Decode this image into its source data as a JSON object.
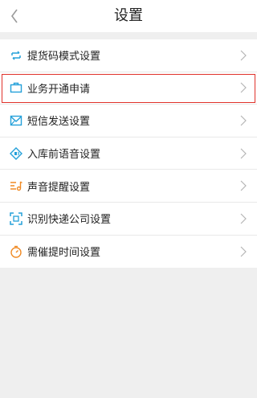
{
  "header": {
    "title": "设置",
    "back_icon": "chevron-left-icon"
  },
  "settings": {
    "items": [
      {
        "label": "提货码模式设置",
        "icon": "pickup-code-icon"
      },
      {
        "label": "业务开通申请",
        "icon": "briefcase-icon",
        "highlighted": true
      },
      {
        "label": "短信发送设置",
        "icon": "sms-icon"
      },
      {
        "label": "入库前语音设置",
        "icon": "voice-icon"
      },
      {
        "label": "声音提醒设置",
        "icon": "sound-icon"
      },
      {
        "label": "识别快递公司设置",
        "icon": "scan-icon"
      },
      {
        "label": "需催提时间设置",
        "icon": "timer-icon"
      }
    ]
  },
  "colors": {
    "accent": "#24a0d9",
    "orange": "#f08a24",
    "highlight": "#e0322b"
  }
}
